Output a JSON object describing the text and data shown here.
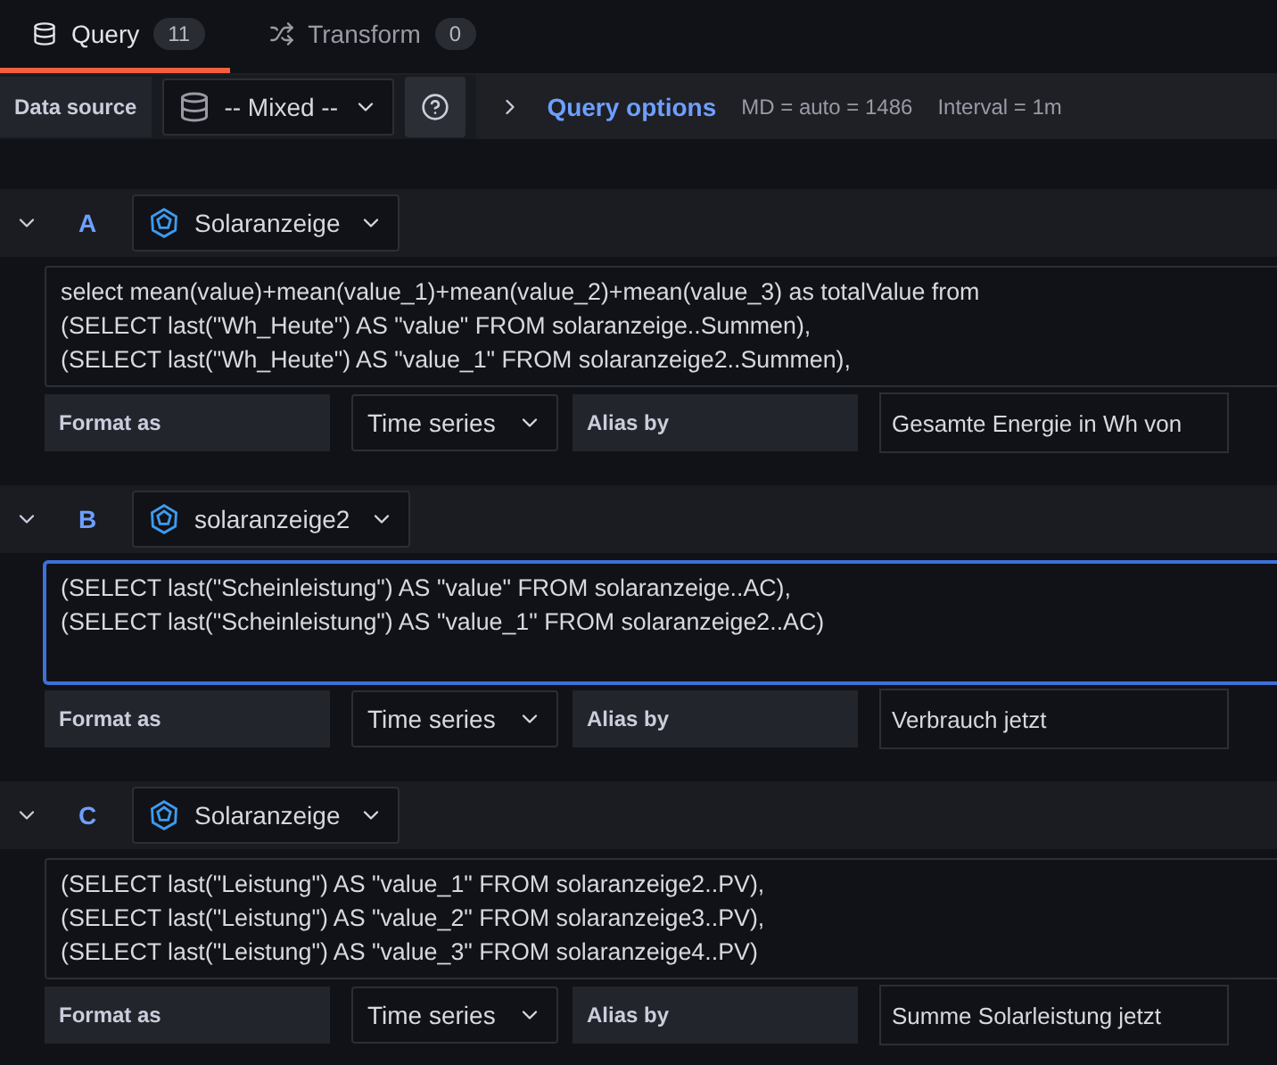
{
  "tabs": [
    {
      "label": "Query",
      "count": "11",
      "selected": true
    },
    {
      "label": "Transform",
      "count": "0",
      "selected": false
    }
  ],
  "toolbar": {
    "data_source_label": "Data source",
    "data_source": "-- Mixed --",
    "query_options": "Query options",
    "md": "MD = auto = 1486",
    "interval": "Interval = 1m"
  },
  "queries": [
    {
      "ref": "A",
      "datasource": "Solaranzeige",
      "focused": false,
      "lines": [
        "select mean(value)+mean(value_1)+mean(value_2)+mean(value_3) as totalValue from",
        "(SELECT last(\"Wh_Heute\") AS \"value\" FROM solaranzeige..Summen),",
        "(SELECT last(\"Wh_Heute\") AS \"value_1\" FROM solaranzeige2..Summen),"
      ],
      "format_label": "Format as",
      "format": "Time series",
      "alias_label": "Alias by",
      "alias": "Gesamte Energie in Wh von"
    },
    {
      "ref": "B",
      "datasource": "solaranzeige2",
      "focused": true,
      "lines": [
        "(SELECT last(\"Scheinleistung\") AS \"value\" FROM solaranzeige..AC),",
        "(SELECT last(\"Scheinleistung\") AS \"value_1\" FROM solaranzeige2..AC)"
      ],
      "format_label": "Format as",
      "format": "Time series",
      "alias_label": "Alias by",
      "alias": "Verbrauch jetzt"
    },
    {
      "ref": "C",
      "datasource": "Solaranzeige",
      "focused": false,
      "lines": [
        "(SELECT last(\"Leistung\") AS \"value_1\" FROM solaranzeige2..PV),",
        "(SELECT last(\"Leistung\") AS \"value_2\" FROM solaranzeige3..PV),",
        "(SELECT last(\"Leistung\") AS \"value_3\" FROM solaranzeige4..PV)"
      ],
      "format_label": "Format as",
      "format": "Time series",
      "alias_label": "Alias by",
      "alias": "Summe Solarleistung jetzt"
    }
  ]
}
